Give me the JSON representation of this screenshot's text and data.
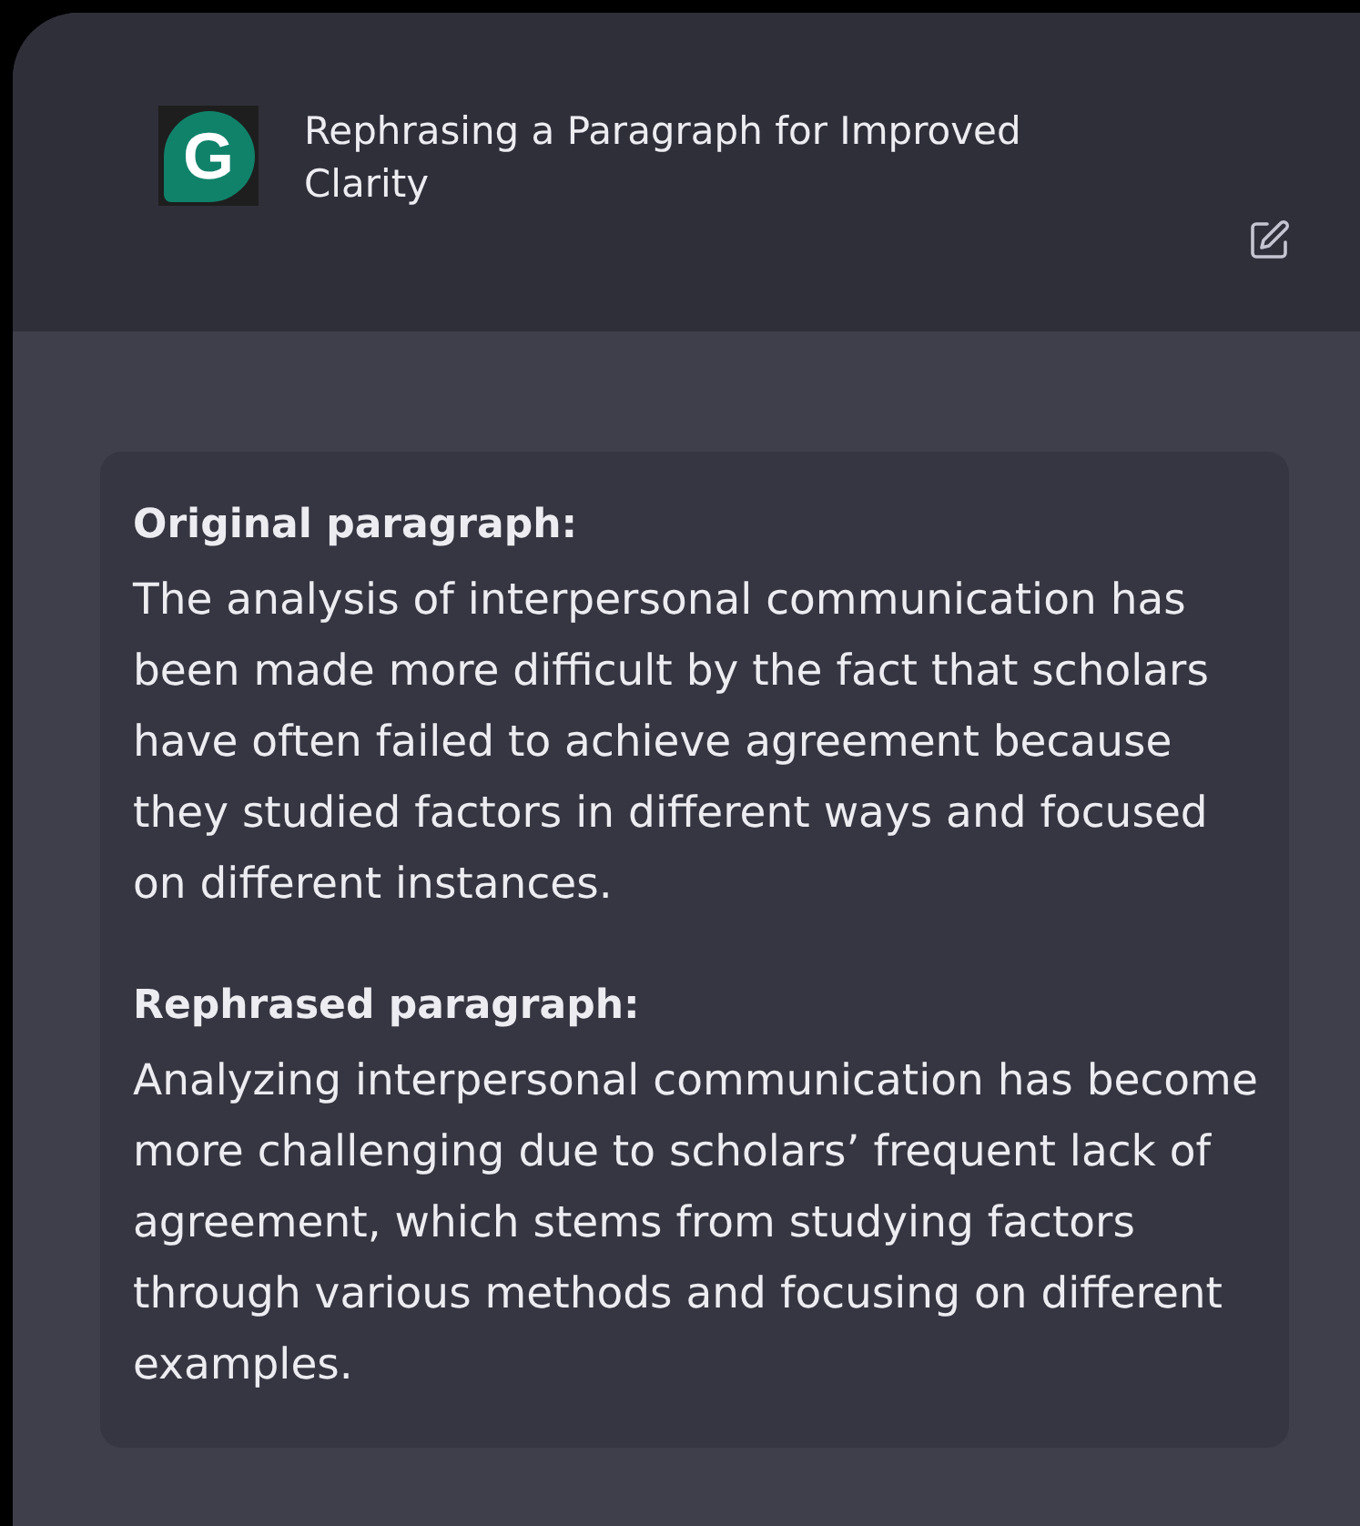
{
  "header": {
    "logo_letter": "G",
    "title": "Rephrasing a Paragraph for Improved Clarity"
  },
  "sections": [
    {
      "heading": "Original paragraph:",
      "text": "The analysis of interpersonal communication has been made more difficult by the fact that scholars have often failed to achieve agreement because they studied factors in different ways and focused on different instances."
    },
    {
      "heading": "Rephrased paragraph:",
      "text": "Analyzing interpersonal communication has become more challenging due to scholars’ frequent lack of agreement, which stems from studying factors through various methods and focusing on different examples."
    }
  ]
}
